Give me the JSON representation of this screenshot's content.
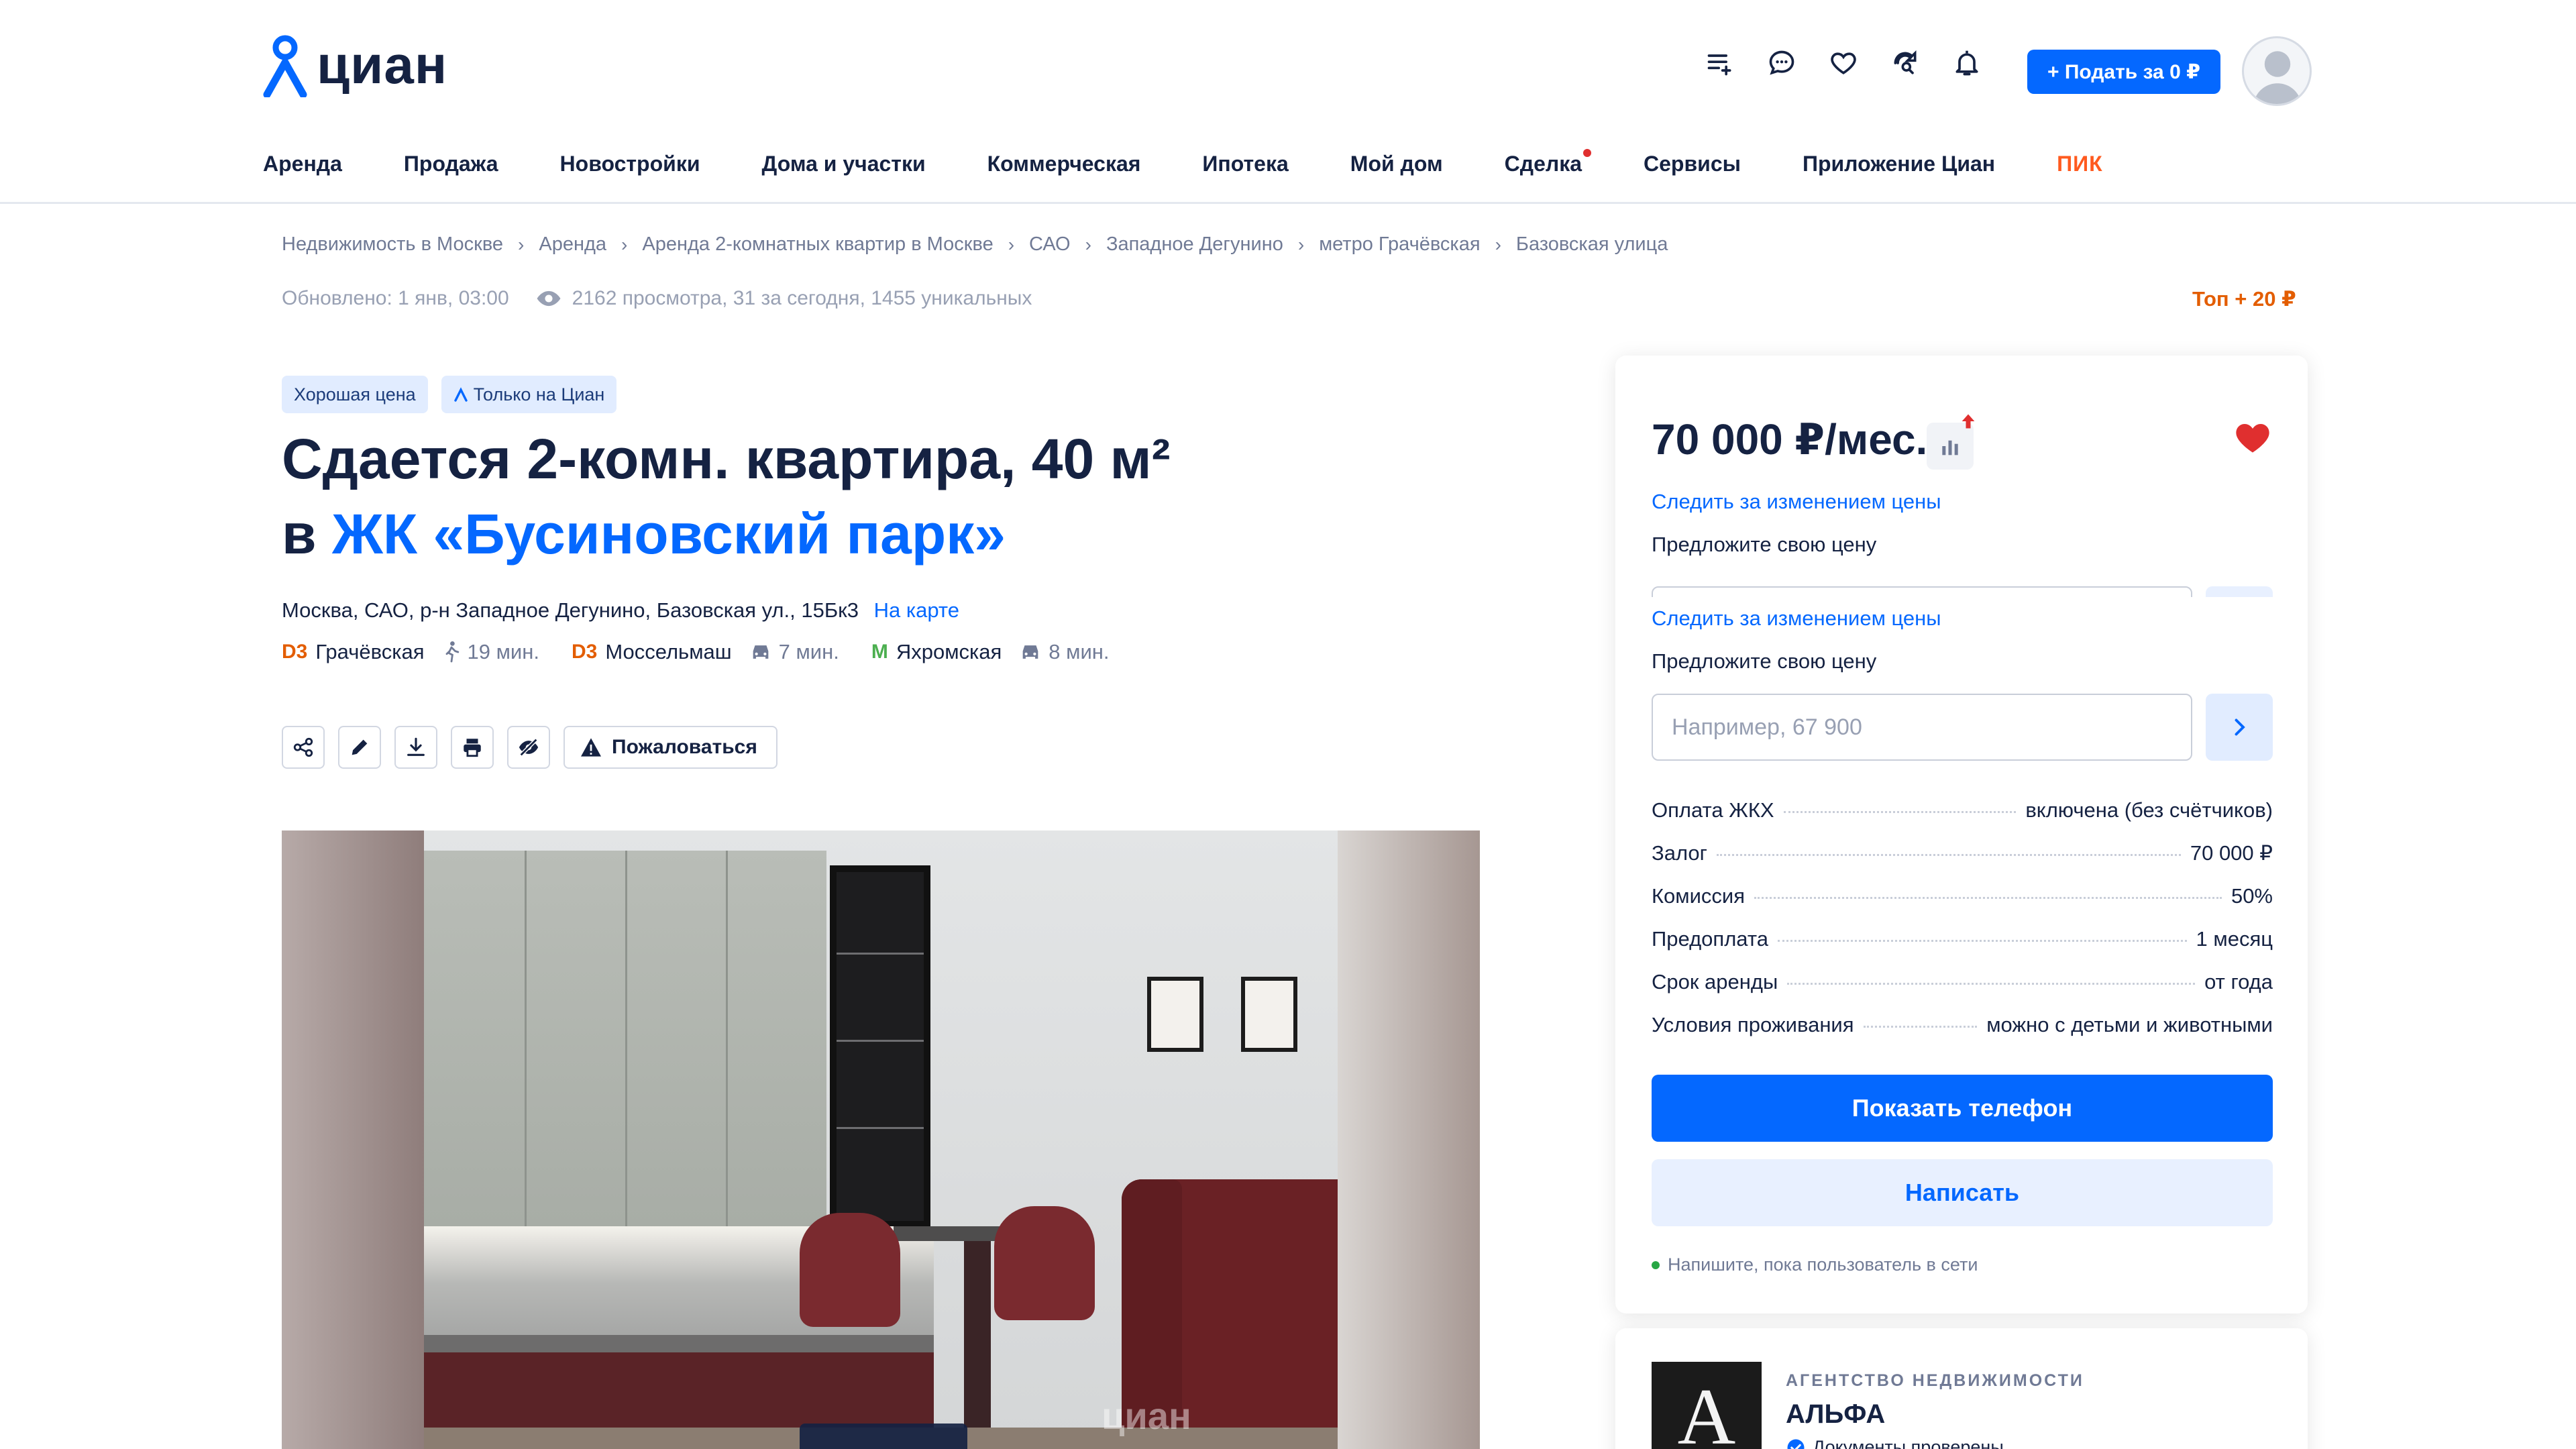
{
  "header": {
    "logo_text": "циан",
    "post_button": "+ Подать за 0 ₽",
    "icons": [
      "compare-list-icon",
      "chat-icon",
      "favorites-heart-icon",
      "saved-search-icon",
      "notifications-bell-icon"
    ]
  },
  "nav": {
    "items": [
      "Аренда",
      "Продажа",
      "Новостройки",
      "Дома и участки",
      "Коммерческая",
      "Ипотека",
      "Мой дом",
      "Сделка",
      "Сервисы",
      "Приложение Циан"
    ],
    "pik": "ПИК"
  },
  "breadcrumbs": [
    "Недвижимость в Москве",
    "Аренда",
    "Аренда 2-комнатных квартир в Москве",
    "САО",
    "Западное Дегунино",
    "метро Грачёвская",
    "Базовская улица"
  ],
  "meta": {
    "updated": "Обновлено: 1 янв, 03:00",
    "views": "2162 просмотра, 31 за сегодня, 1455 уникальных",
    "top": "Топ + 20 ₽"
  },
  "badges": [
    "Хорошая цена",
    "Только на Циан"
  ],
  "title": {
    "line1": "Сдается 2-комн. квартира, 40 м²",
    "prefix2": "в ",
    "complex": "ЖК «Бусиновский парк»"
  },
  "address": {
    "text": "Москва, САО, р-н Западное Дегунино, Базовская ул., 15Бк3",
    "map_link": "На карте"
  },
  "metros": [
    {
      "mark": "D3",
      "color": "#e35d00",
      "name": "Грачёвская",
      "mode": "walk",
      "time": "19 мин."
    },
    {
      "mark": "D3",
      "color": "#e35d00",
      "name": "Моссельмаш",
      "mode": "car",
      "time": "7 мин."
    },
    {
      "mark": "M",
      "color": "#4caf50",
      "name": "Яхромская",
      "mode": "car",
      "time": "8 мин."
    }
  ],
  "toolbar": {
    "complain": "Пожаловаться"
  },
  "gallery": {
    "watermark": "циан"
  },
  "card": {
    "price": "70 000 ₽/мес.",
    "follow_price": "Следить за изменением цены",
    "offer_label": "Предложите свою цену",
    "offer_placeholder": "Например, 67 900",
    "details": [
      {
        "label": "Оплата ЖКХ",
        "value": "включена (без счётчиков)"
      },
      {
        "label": "Залог",
        "value": "70 000 ₽"
      },
      {
        "label": "Комиссия",
        "value": "50%"
      },
      {
        "label": "Предоплата",
        "value": "1 месяц"
      },
      {
        "label": "Срок аренды",
        "value": "от года"
      },
      {
        "label": "Условия проживания",
        "value": "можно с детьми и животными"
      }
    ],
    "show_phone": "Показать телефон",
    "write": "Написать",
    "online_note": "Напишите, пока пользователь в сети"
  },
  "agency": {
    "logo_letter": "A",
    "type": "АГЕНТСТВО НЕДВИЖИМОСТИ",
    "name": "АЛЬФА",
    "verified": "Документы проверены"
  },
  "colors": {
    "accent": "#0468ff",
    "text": "#152242",
    "muted": "#707a95",
    "badge_bg": "#e1ecff",
    "top_orange": "#e35d00"
  }
}
